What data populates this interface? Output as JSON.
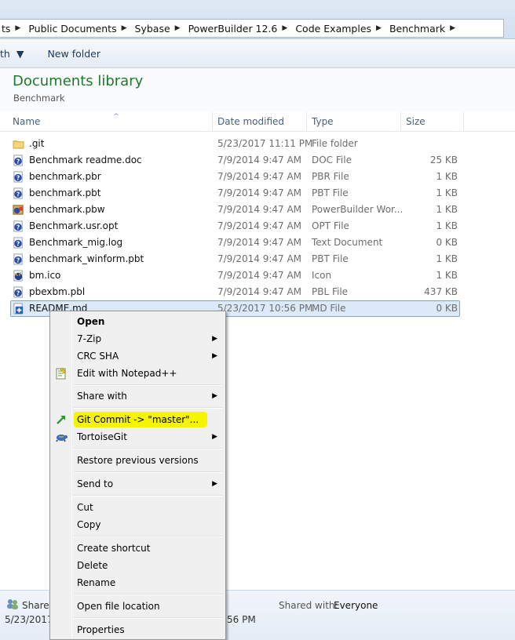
{
  "address": {
    "crumbs": [
      "ts",
      "Public Documents",
      "Sybase",
      "PowerBuilder 12.6",
      "Code Examples",
      "Benchmark"
    ]
  },
  "toolbar": {
    "share_label": "th",
    "new_folder_label": "New folder"
  },
  "library": {
    "title": "Documents library",
    "subtitle": "Benchmark"
  },
  "columns": {
    "name": "Name",
    "date": "Date modified",
    "type": "Type",
    "size": "Size"
  },
  "files": [
    {
      "name": ".git",
      "date": "5/23/2017 11:11 PM",
      "type": "File folder",
      "size": "",
      "icon": "folder-icon"
    },
    {
      "name": "Benchmark readme.doc",
      "date": "7/9/2014 9:47 AM",
      "type": "DOC File",
      "size": "25 KB",
      "icon": "unknown-file-icon"
    },
    {
      "name": "benchmark.pbr",
      "date": "7/9/2014 9:47 AM",
      "type": "PBR File",
      "size": "1 KB",
      "icon": "unknown-file-icon"
    },
    {
      "name": "benchmark.pbt",
      "date": "7/9/2014 9:47 AM",
      "type": "PBT File",
      "size": "1 KB",
      "icon": "unknown-file-icon"
    },
    {
      "name": "benchmark.pbw",
      "date": "7/9/2014 9:47 AM",
      "type": "PowerBuilder Wor...",
      "size": "1 KB",
      "icon": "powerbuilder-workspace-icon"
    },
    {
      "name": "Benchmark.usr.opt",
      "date": "7/9/2014 9:47 AM",
      "type": "OPT File",
      "size": "1 KB",
      "icon": "unknown-file-icon"
    },
    {
      "name": "Benchmark_mig.log",
      "date": "7/9/2014 9:47 AM",
      "type": "Text Document",
      "size": "0 KB",
      "icon": "unknown-file-icon"
    },
    {
      "name": "benchmark_winform.pbt",
      "date": "7/9/2014 9:47 AM",
      "type": "PBT File",
      "size": "1 KB",
      "icon": "unknown-file-icon"
    },
    {
      "name": "bm.ico",
      "date": "7/9/2014 9:47 AM",
      "type": "Icon",
      "size": "1 KB",
      "icon": "ico-file-icon"
    },
    {
      "name": "pbexbm.pbl",
      "date": "7/9/2014 9:47 AM",
      "type": "PBL File",
      "size": "437 KB",
      "icon": "unknown-file-icon"
    },
    {
      "name": "README.md",
      "date": "5/23/2017 10:56 PM",
      "type": "MD File",
      "size": "0 KB",
      "icon": "git-added-file-icon",
      "selected": true
    }
  ],
  "context_menu": {
    "items": [
      {
        "label": "Open",
        "bold": true
      },
      {
        "label": "7-Zip",
        "submenu": true
      },
      {
        "label": "CRC SHA",
        "submenu": true
      },
      {
        "label": "Edit with Notepad++",
        "icon": "notepadpp-icon"
      },
      {
        "label": "Share with",
        "submenu": true
      },
      {
        "label": "Git Commit -> \"master\"...",
        "icon": "git-commit-icon",
        "highlighted": true
      },
      {
        "label": "TortoiseGit",
        "submenu": true,
        "icon": "tortoisegit-icon"
      },
      {
        "label": "Restore previous versions"
      },
      {
        "label": "Send to",
        "submenu": true
      },
      {
        "label": "Cut"
      },
      {
        "label": "Copy"
      },
      {
        "label": "Create shortcut"
      },
      {
        "label": "Delete"
      },
      {
        "label": "Rename"
      },
      {
        "label": "Open file location"
      },
      {
        "label": "Properties"
      }
    ],
    "highlight_color": "#f5f500"
  },
  "status": {
    "shared_label": "Shared",
    "date_fragment": "5/23/2017",
    "time_fragment": "56 PM",
    "shared_with_label": "Shared with:",
    "shared_with_value": "Everyone"
  }
}
